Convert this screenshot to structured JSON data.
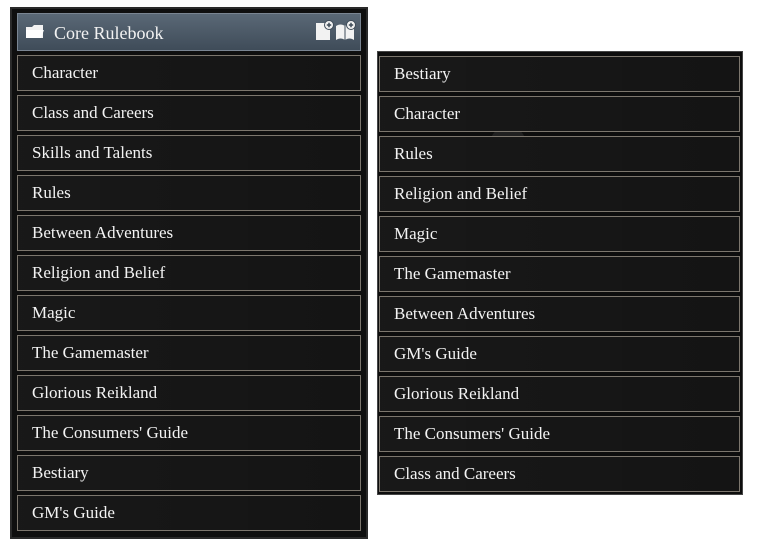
{
  "left_panel": {
    "header": {
      "title": "Core Rulebook",
      "icons": [
        "folder-open-icon",
        "add-page-icon",
        "add-book-icon"
      ]
    },
    "items": [
      "Character",
      "Class and Careers",
      "Skills and Talents",
      "Rules",
      "Between Adventures",
      "Religion and Belief",
      "Magic",
      "The Gamemaster",
      "Glorious Reikland",
      "The Consumers' Guide",
      "Bestiary",
      "GM's Guide"
    ]
  },
  "right_panel": {
    "items": [
      "Bestiary",
      "Character",
      "Rules",
      "Religion and Belief",
      "Magic",
      "The Gamemaster",
      "Between Adventures",
      "GM's Guide",
      "Glorious Reikland",
      "The Consumers' Guide",
      "Class and Careers"
    ]
  },
  "colors": {
    "header_bg": "#4b5966",
    "item_border": "#7c766d",
    "text": "#f3f3f3"
  }
}
